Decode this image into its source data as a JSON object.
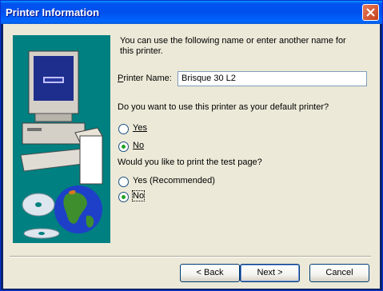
{
  "window": {
    "title": "Printer Information"
  },
  "content": {
    "intro": "You can use the following name or enter another name for this printer.",
    "printer_name": {
      "label": "Printer Name:",
      "value": "Brisque 30 L2"
    },
    "default_question": "Do you want to use this printer as your default printer?",
    "default_options": [
      {
        "label": "Yes",
        "selected": false
      },
      {
        "label": "No",
        "selected": true
      }
    ],
    "test_question": "Would you like to print the test page?",
    "test_options": [
      {
        "label": "Yes (Recommended)",
        "selected": false
      },
      {
        "label": "No",
        "selected": true
      }
    ]
  },
  "buttons": {
    "back": "< Back",
    "next": "Next >",
    "cancel": "Cancel"
  },
  "colors": {
    "title_bar": "#0054E3",
    "dialog_bg": "#ECE9D8",
    "illustration_bg": "#008080",
    "close_button": "#D8532E"
  },
  "icons": [
    "close-icon",
    "computer-illustration",
    "cd-discs-illustration",
    "globe-illustration"
  ]
}
